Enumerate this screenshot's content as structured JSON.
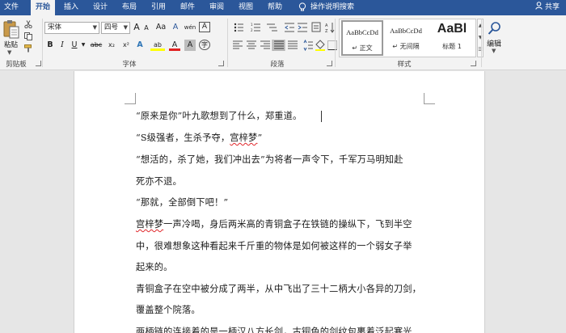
{
  "tabs": [
    "文件",
    "开始",
    "插入",
    "设计",
    "布局",
    "引用",
    "邮件",
    "审阅",
    "视图",
    "帮助",
    "操作说明搜索"
  ],
  "share_label": "共享",
  "clipboard": {
    "paste_label": "粘贴",
    "group_label": "剪贴板"
  },
  "font": {
    "font_name": "宋体",
    "font_size": "四号",
    "group_label": "字体",
    "wen_glyph": "wén",
    "big_a": "A",
    "aa_label": "Aa",
    "bold": "B",
    "italic": "I",
    "underline": "U",
    "strike": "abc",
    "subscript": "x₂",
    "superscript": "x²",
    "clear": "A",
    "highlight": "ab",
    "font_color": "A",
    "char_shade": "A",
    "enclose": "字"
  },
  "paragraph": {
    "group_label": "段落"
  },
  "styles": {
    "group_label": "样式",
    "items": [
      {
        "sample": "AaBbCcDd",
        "name": "↵ 正文"
      },
      {
        "sample": "AaBbCcDd",
        "name": "↵ 无间隔"
      },
      {
        "sample": "AaBl",
        "name": "标题 1"
      }
    ]
  },
  "editing": {
    "label": "编辑"
  },
  "document": {
    "lines": [
      "“原来是你”叶九歌想到了什么，郑重道。",
      "“S级强者，生杀予夺，",
      "宫梓梦",
      "”",
      "“想活的，杀了她，我们冲出去”为将者一声令下，千军万马明知赴",
      "死亦不退。",
      "“那就，全部倒下吧！”",
      "宫梓梦",
      "一声冷喝，身后两米高的青铜盒子在铁链的操纵下，飞到半空",
      "中，很难想象这种看起来千斤重的物体是如何被这样的一个弱女子举",
      "起来的。",
      "青铜盒子在空中被分成了两半，从中飞出了三十二柄大小各异的刀剑，",
      "覆盖整个院落。",
      "两柄链的连接着的是一柄汉八方长剑，古铜色的剑纹包裹着泛起寒光"
    ]
  }
}
